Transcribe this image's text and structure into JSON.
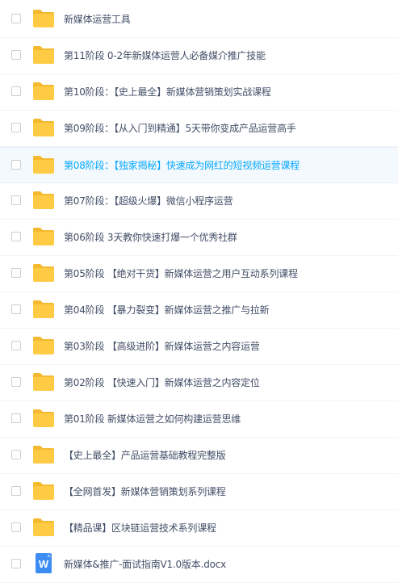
{
  "files": [
    {
      "name": "新媒体运营工具",
      "type": "folder-icon"
    },
    {
      "name": "第11阶段 0-2年新媒体运营人必备媒介推广技能",
      "type": "folder-icon"
    },
    {
      "name": "第10阶段：【史上最全】新媒体营销策划实战课程",
      "type": "folder-icon"
    },
    {
      "name": "第09阶段：【从入门到精通】5天带你变成产品运营高手",
      "type": "folder-icon"
    },
    {
      "name": "第08阶段：【独家揭秘】快速成为网红的短视频运营课程",
      "type": "folder-icon",
      "hover": true
    },
    {
      "name": "第07阶段：【超级火爆】微信小程序运营",
      "type": "folder-icon"
    },
    {
      "name": "第06阶段 3天教你快速打爆一个优秀社群",
      "type": "folder-icon"
    },
    {
      "name": "第05阶段 【绝对干货】新媒体运营之用户互动系列课程",
      "type": "folder-icon"
    },
    {
      "name": "第04阶段 【暴力裂变】新媒体运营之推广与拉新",
      "type": "folder-icon"
    },
    {
      "name": "第03阶段 【高级进阶】新媒体运营之内容运营",
      "type": "folder-icon"
    },
    {
      "name": "第02阶段 【快速入门】新媒体运营之内容定位",
      "type": "folder-icon"
    },
    {
      "name": "第01阶段 新媒体运营之如何构建运营思维",
      "type": "folder-icon"
    },
    {
      "name": "【史上最全】产品运营基础教程完整版",
      "type": "folder-icon"
    },
    {
      "name": "【全网首发】新媒体营销策划系列课程",
      "type": "folder-icon"
    },
    {
      "name": "【精品课】区块链运营技术系列课程",
      "type": "folder-icon"
    },
    {
      "name": "新媒体&推广-面试指南V1.0版本.docx",
      "type": "word-doc-icon",
      "icon_letter": "W"
    }
  ],
  "colors": {
    "folder": "#ffcb45",
    "folder_tab": "#f4b92f",
    "word": "#3d8cf4",
    "hover_text": "#06a7ff",
    "text": "#424e67"
  }
}
